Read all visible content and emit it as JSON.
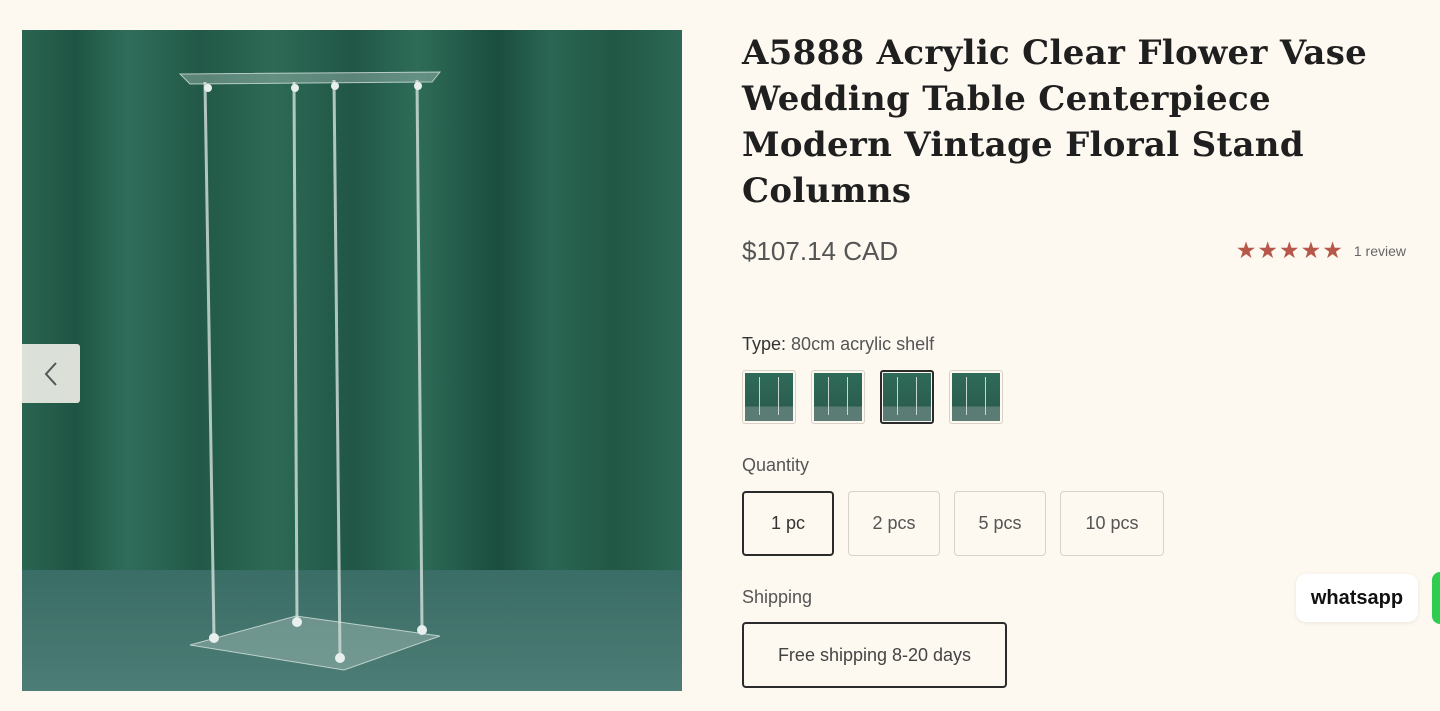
{
  "product": {
    "title": "A5888 Acrylic Clear Flower Vase Wedding Table Centerpiece Modern Vintage Floral Stand Columns",
    "price": "$107.14 CAD",
    "rating": {
      "stars": "★★★★★",
      "value": 5,
      "out_of": 5,
      "review_count": "1 review"
    }
  },
  "gallery": {
    "image_alt": "acrylic-flower-stand-photo",
    "prev_icon": "chevron-left-icon"
  },
  "type_selector": {
    "label": "Type:",
    "selected": "80cm acrylic shelf",
    "swatch_count": 4,
    "selected_index": 2
  },
  "quantity": {
    "label": "Quantity",
    "options": [
      "1 pc",
      "2 pcs",
      "5 pcs",
      "10 pcs"
    ],
    "selected_index": 0
  },
  "shipping": {
    "label": "Shipping",
    "option": "Free shipping 8-20 days"
  },
  "whatsapp": {
    "label": "whatsapp"
  },
  "colors": {
    "background": "#fdf9f1",
    "curtain_green": "#2b6a55",
    "star_color": "#b6574a"
  }
}
